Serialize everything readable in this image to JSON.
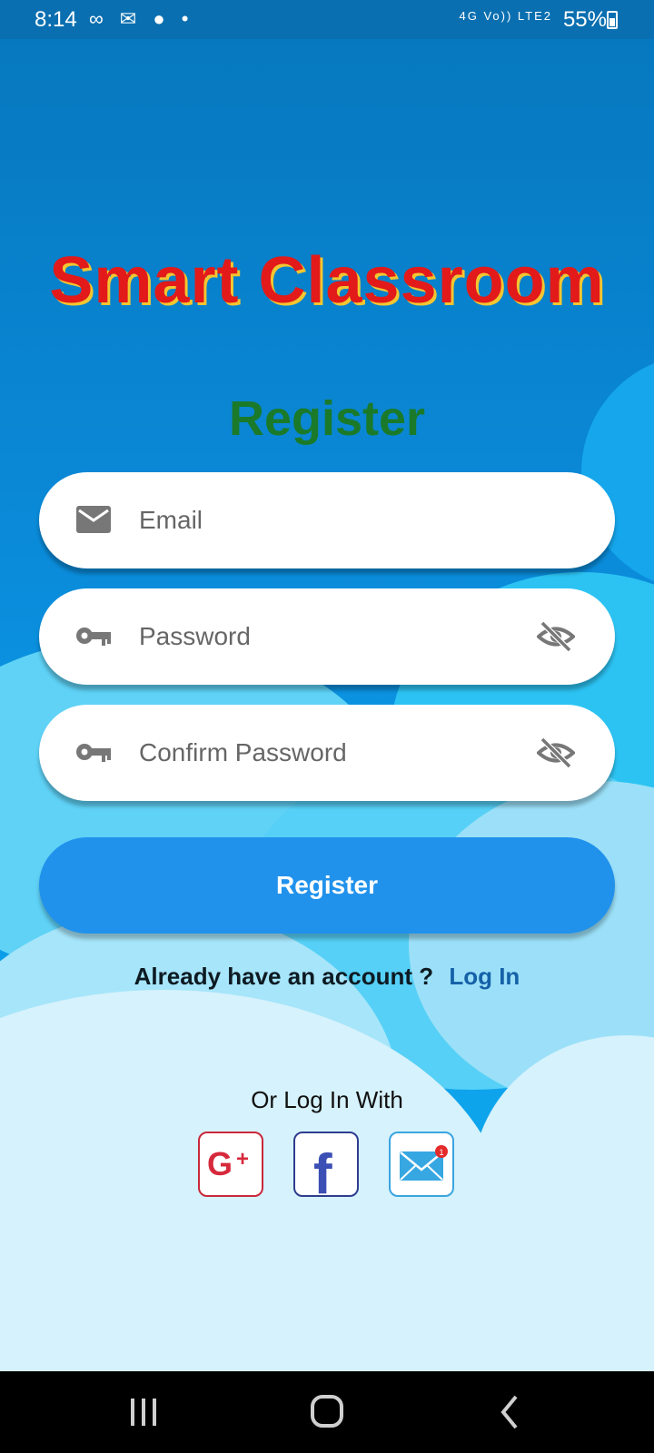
{
  "status_bar": {
    "time": "8:14",
    "battery": "55%",
    "network": "4G  Vo)) LTE2"
  },
  "app": {
    "title": "Smart Classroom"
  },
  "form": {
    "title": "Register",
    "email_placeholder": "Email",
    "password_placeholder": "Password",
    "confirm_placeholder": "Confirm Password",
    "submit_label": "Register"
  },
  "footer": {
    "already_text": "Already have an account ?",
    "login_link": "Log In",
    "or_text": "Or Log In With",
    "mail_badge": "1"
  },
  "icons": [
    "mail-icon",
    "key-icon",
    "eye-off-icon",
    "google-plus-icon",
    "facebook-icon",
    "email-app-icon",
    "recent-apps-icon",
    "home-icon",
    "back-icon"
  ],
  "colors": {
    "title_red": "#e21a1a",
    "register_green": "#1a7a2a",
    "button_blue": "#2192ec",
    "link_blue": "#1561a8"
  }
}
